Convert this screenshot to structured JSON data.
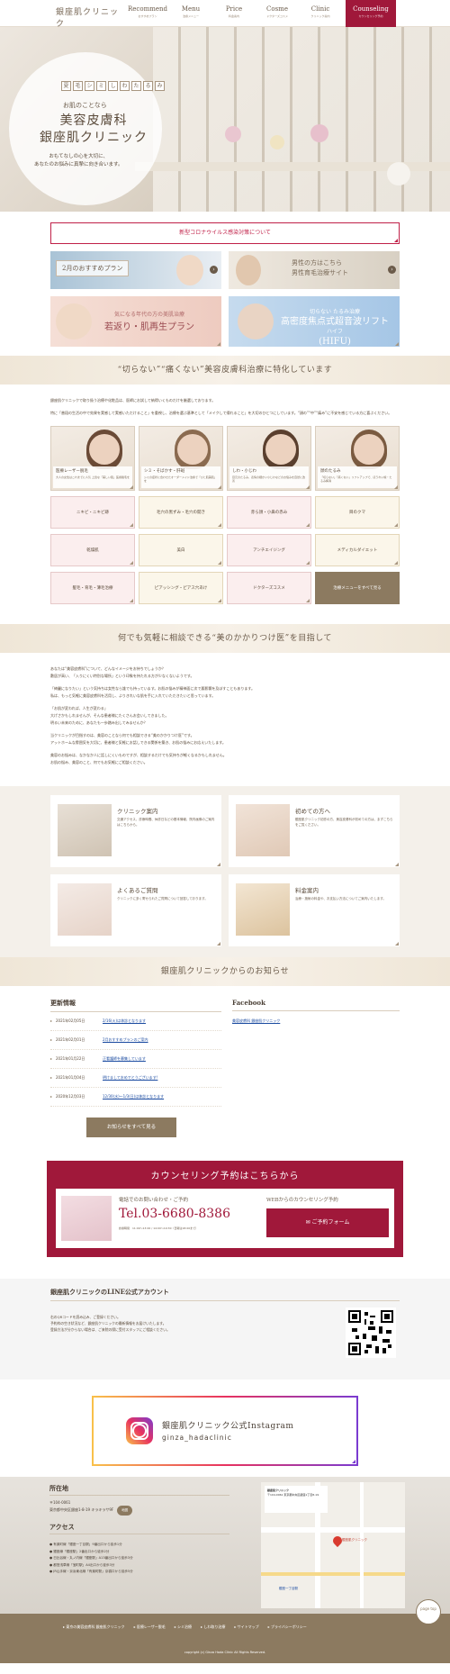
{
  "header": {
    "logo": "銀座肌クリニック",
    "logo_sub": "GINZA HADA CLINIC",
    "nav": [
      {
        "en": "Recommend",
        "jp": "おすすめプラン"
      },
      {
        "en": "Menu",
        "jp": "治療メニュー"
      },
      {
        "en": "Price",
        "jp": "料金案内"
      },
      {
        "en": "Cosme",
        "jp": "ドクターズコスメ"
      },
      {
        "en": "Clinic",
        "jp": "クリニック案内"
      },
      {
        "en": "Counseling",
        "jp": "カウンセリング予約"
      }
    ]
  },
  "hero": {
    "tags": [
      "夏",
      "毛",
      "シ",
      "ミ",
      "し",
      "わ",
      "た",
      "る",
      "み"
    ],
    "sub": "お肌のことなら",
    "title1": "美容皮膚科",
    "title2": "銀座肌クリニック",
    "lead1": "おもてなしの心を大切に、",
    "lead2": "あなたのお悩みに真摯に向き合います。"
  },
  "notice": "新型コロナウイルス感染対策について",
  "banners": {
    "b1": "2月のおすすめプラン",
    "b2_1": "男性の方はこちら",
    "b2_2": "男性育毛治療サイト",
    "b3_1": "気になる年代の方の美肌治療",
    "b3_2": "若返り・肌再生プラン",
    "b4_1": "切らない たるみ治療",
    "b4_2": "高密度焦点式超音波リフト",
    "b4_3": "ハイフ",
    "b4_4": "(HIFU)"
  },
  "section1": {
    "heading": "“切らない”“痛くない”美容皮膚科治療に特化しています",
    "p1": "銀座肌クリニックで取り扱う治療や化粧品は、医師にお試して納得いくものだけを厳選しております。",
    "p2": "特に「普段の生活の中で効果を実感して実感いただけること」を重視し、治療を選ぶ基準として「メイクして帰れること」を大切のひとつにしています。“顔の”“中”“痛み”に不安を感じている方に喜ぶください。"
  },
  "treatments": [
    {
      "title": "医療レーザー脱毛",
      "desc": "大人の女性はこれまでに人気 上質な「美しい肌」医療脱毛を"
    },
    {
      "title": "シミ・そばかす・肝斑",
      "desc": "シミの症状に合わせたオーダーメイド治療で「ひと肌美肌」を"
    },
    {
      "title": "しわ・小じわ",
      "desc": "目元のたるみ、表情の細かい小じわなどのお悩みを自然に改善"
    },
    {
      "title": "顔のたるみ",
      "desc": "「切らない」「痛くない」リフトアップで、ほうれい線・たるみ解消"
    }
  ],
  "treatment_buttons": [
    "ニキビ・ニキビ跡",
    "毛穴の黒ずみ・毛穴の開き",
    "赤ら顔・小鼻の赤み",
    "目のクマ",
    "乾燥肌",
    "美白",
    "アンチエイジング",
    "メディカルダイエット",
    "髪毛・育毛・薄毛治療",
    "ピアッシング・ピアス穴あけ",
    "ドクターズコスメ",
    "治療メニューをすべて見る"
  ],
  "section2": {
    "heading": "何でも気軽に相談できる“美のかかりつけ医”を目指して",
    "p1": "あなたは“美容皮膚科”について、どんなイメージをお持ちでしょうか？",
    "p2": "敷居が高い、「入りにくい特別な場所」という印象を持たれる方が少なくないようです。",
    "p3": "「綺麗になりたい」という気持ちは女性なら誰でも持っています。お肌の悩みが精神面に次で悪影響を及ぼすこともあります。",
    "p4": "私は、もっと気軽に美容皮膚科を活用し、よりきれいな肌を手に入れていただきたいと思っています。",
    "p5": "「お肌が変われば、人生が変わる」",
    "p6": "大げさかもしれませんが、そんな患者様にたくさんお会いしてきました。",
    "p7": "明るい未来のために、あなたも一歩踏み出してみませんか？",
    "p8": "当クリニックが目指すのは、美容のことなら何でも相談できる“美のかかりつけ医”です。",
    "p9": "アットホームな雰囲気を大切に、患者様と気軽にお話しできる関係を築き、お肌の悩みにお応えいたします。",
    "p10": "美容のお悩みは、なかなか人に話しにくいものですが、相談するだけでも気持ちが軽くなるかもしれません。",
    "p11": "お肌の悩み、美容のこと、何でもお気軽にご相談ください。"
  },
  "info": [
    {
      "title": "クリニック案内",
      "desc": "交通アクセス、診療時間、休診日などの基本情報、院内画像のご案内はこちらから。"
    },
    {
      "title": "初めての方へ",
      "desc": "銀座肌クリニック初診の方、美容皮膚科が初めての方は、まずこちらをご覧ください。"
    },
    {
      "title": "よくあるご質問",
      "desc": "クリニックに多く寄せられたご質問について回答しております。"
    },
    {
      "title": "料金案内",
      "desc": "治療・施術の料金や、お支払い方法についてご案内いたします。"
    }
  ],
  "news": {
    "heading": "銀座肌クリニックからのお知らせ",
    "update_title": "更新情報",
    "items": [
      {
        "date": "2021年02月05日",
        "title": "2/16(火)は休診となります"
      },
      {
        "date": "2021年02月01日",
        "title": "2月おすすめプランのご案内"
      },
      {
        "date": "2021年01月22日",
        "title": "正看護師を募集しています"
      },
      {
        "date": "2021年01月04日",
        "title": "明けましておめでとうございます!"
      },
      {
        "date": "2020年12月03日",
        "title": "12/30(水)～1/3(日)は休診となります"
      }
    ],
    "more": "お知らせをすべて見る",
    "facebook_title": "Facebook",
    "facebook_link": "美容皮膚科 銀座肌クリニック"
  },
  "counseling": {
    "heading": "カウンセリング予約はこちらから",
    "tel_label": "電話でのお問い合わせ・ご予約",
    "tel": "Tel.03-6680-8386",
    "hours": "診療時間　11:00～13:00 / 14:00～19:30（日曜は18:00まで）",
    "web_label": "WEBからのカウンセリング予約",
    "form_btn": "ご予約フォーム"
  },
  "line": {
    "title": "銀座肌クリニックのLINE公式アカウント",
    "t1": "右のQRコードを読み込み、ご登録ください。",
    "t2": "予約枠の空き状況など、銀座肌クリニックの最新情報をお届けいたします。",
    "t3": "登録方法が分からない場合は、ご来院の際に受付スタッフにご相談ください。"
  },
  "instagram": {
    "name": "銀座肌クリニック公式Instagram",
    "handle": "ginza_hadaclinic"
  },
  "access": {
    "title": "所在地",
    "zip": "〒104-0061",
    "addr": "東京都中央区銀座1-8-19 キラキラサ9F",
    "map_btn": "地図",
    "access_title": "アクセス",
    "routes": [
      "有楽町線「銀座一丁目駅」9番出口から徒歩1分",
      "銀座線「銀座駅」2番出口から徒歩2分",
      "日比谷線・丸ノ内線「銀座駅」A13番出口から徒歩3分",
      "都営浅草線「宝町駅」A4出口から徒歩3分",
      "JR山手線・京浜東北線「有楽町駅」京橋口から徒歩5分"
    ],
    "map_label": "銀座肌クリニック",
    "map_addr": "〒104-0061 東京都中央区銀座1丁目8-19",
    "map_station": "銀座一丁目駅"
  },
  "footer": {
    "links": [
      "東京の美容皮膚科 銀座肌クリニック",
      "医療レーザー脱毛",
      "シミ治療",
      "しわ取り治療",
      "サイトマップ",
      "プライバシーポリシー"
    ],
    "copy": "copyright (c) Ginza Hada Clinic All Rights Reserved.",
    "pagetop": "page top"
  }
}
